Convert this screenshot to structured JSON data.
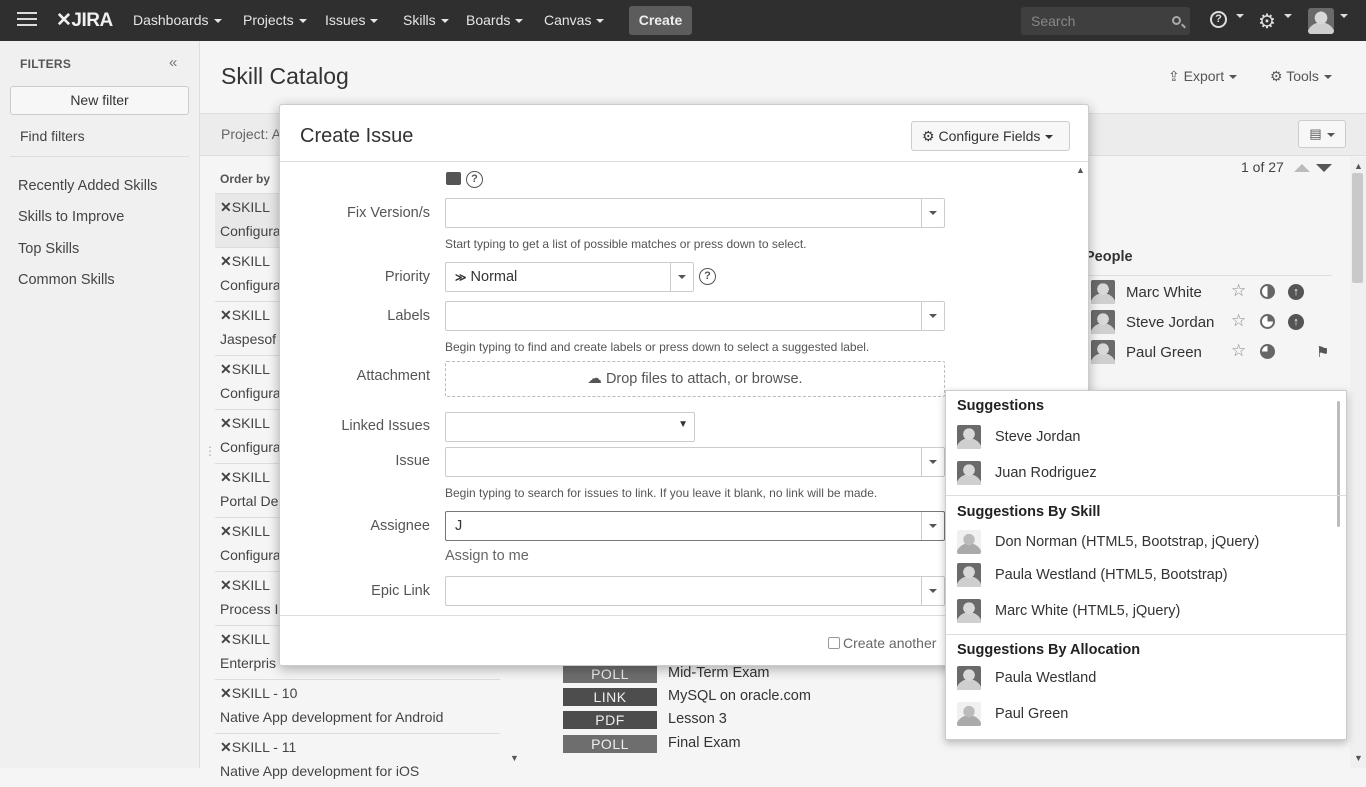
{
  "nav": {
    "logo": "JIRA",
    "items": [
      "Dashboards",
      "Projects",
      "Issues",
      "Skills",
      "Boards",
      "Canvas"
    ],
    "create": "Create",
    "search_placeholder": "Search"
  },
  "sidebar": {
    "title": "FILTERS",
    "new_filter": "New filter",
    "find_filters": "Find filters",
    "items": [
      "Recently Added Skills",
      "Skills to Improve",
      "Top Skills",
      "Common Skills"
    ]
  },
  "page": {
    "title": "Skill Catalog",
    "export": "Export",
    "tools": "Tools",
    "project_label": "Project: A",
    "order_by": "Order by",
    "pager": "1 of 27"
  },
  "issues": [
    {
      "key": "SKILL",
      "summary": "Configura"
    },
    {
      "key": "SKILL",
      "summary": "Configura"
    },
    {
      "key": "SKILL",
      "summary": "Jaspesof"
    },
    {
      "key": "SKILL",
      "summary": "Configura"
    },
    {
      "key": "SKILL",
      "summary": "Configura"
    },
    {
      "key": "SKILL",
      "summary": "Portal De"
    },
    {
      "key": "SKILL",
      "summary": "Configura"
    },
    {
      "key": "SKILL",
      "summary": "Process I"
    },
    {
      "key": "SKILL",
      "summary": "Enterpris"
    },
    {
      "key": "SKILL - 10",
      "summary": "Native App development for Android"
    },
    {
      "key": "SKILL - 11",
      "summary": "Native App development for iOS"
    }
  ],
  "people": {
    "title": "People",
    "list": [
      {
        "name": "Marc White",
        "icon2": "↑"
      },
      {
        "name": "Steve Jordan",
        "icon2": "↑"
      },
      {
        "name": "Paul Green",
        "icon2": ""
      }
    ]
  },
  "attachments": [
    {
      "type": "POLL",
      "title": "Mid-Term Exam"
    },
    {
      "type": "LINK",
      "title": "MySQL on oracle.com"
    },
    {
      "type": "PDF",
      "title": "Lesson 3"
    },
    {
      "type": "POLL",
      "title": "Final Exam"
    }
  ],
  "dialog": {
    "title": "Create Issue",
    "configure_fields": "Configure Fields",
    "fix_version_label": "Fix Version/s",
    "fix_version_help": "Start typing to get a list of possible matches or press down to select.",
    "priority_label": "Priority",
    "priority_value": "Normal",
    "labels_label": "Labels",
    "labels_help": "Begin typing to find and create labels or press down to select a suggested label.",
    "attachment_label": "Attachment",
    "attachment_drop": "Drop files to attach, or browse.",
    "linked_issues_label": "Linked Issues",
    "issue_label": "Issue",
    "issue_help": "Begin typing to search for issues to link. If you leave it blank, no link will be made.",
    "assignee_label": "Assignee",
    "assignee_value": "J",
    "assign_to_me": "Assign to me",
    "epic_link_label": "Epic Link",
    "create_another": "Create another"
  },
  "suggestions": {
    "headers": [
      "Suggestions",
      "Suggestions By Skill",
      "Suggestions By Allocation"
    ],
    "group1": [
      "Steve Jordan",
      "Juan Rodriguez"
    ],
    "group2": [
      "Don Norman  (HTML5, Bootstrap, jQuery)",
      "Paula Westland (HTML5, Bootstrap)",
      "Marc White (HTML5, jQuery)"
    ],
    "group3": [
      "Paula Westland",
      "Paul Green"
    ]
  }
}
